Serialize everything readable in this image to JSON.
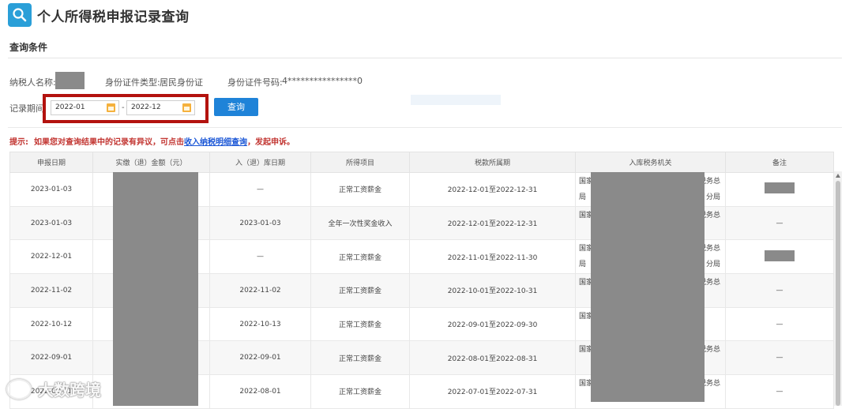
{
  "header": {
    "title": "个人所得税申报记录查询",
    "icon": "search-icon"
  },
  "section": {
    "title": "查询条件"
  },
  "fields": {
    "taxpayer_label": "纳税人名称:",
    "id_type_label": "身份证件类型:",
    "id_type_value": "居民身份证",
    "id_no_label": "身份证件号码:",
    "id_no_value": "4****************0",
    "period_label": "记录期间:",
    "date_from": "2022-01",
    "date_to": "2022-12",
    "date_sep": "-"
  },
  "query_button": "查询",
  "hint": {
    "prefix": "提示:",
    "text1": "如果您对查询结果中的记录有异议，可点击",
    "link": "收入纳税明细查询",
    "text2": "，发起申诉。"
  },
  "table": {
    "headers": [
      "申报日期",
      "实缴（退）金额（元）",
      "入（退）库日期",
      "所得项目",
      "税款所属期",
      "入库税务机关",
      "备注"
    ],
    "rows": [
      {
        "date": "2023-01-03",
        "stock_date": "—",
        "item": "正常工资薪金",
        "period": "2022-12-01至2022-12-31",
        "office1": "国家",
        "office2": "税务总",
        "office3": "局",
        "office4": "分局",
        "note": ""
      },
      {
        "date": "2023-01-03",
        "stock_date": "2023-01-03",
        "item": "全年一次性奖金收入",
        "period": "2022-12-01至2022-12-31",
        "office1": "国家",
        "office2": "税务总",
        "office3": "",
        "office4": "",
        "note": "—"
      },
      {
        "date": "2022-12-01",
        "stock_date": "—",
        "item": "正常工资薪金",
        "period": "2022-11-01至2022-11-30",
        "office1": "国家",
        "office2": "税务总",
        "office3": "局",
        "office4": "分局",
        "note": ""
      },
      {
        "date": "2022-11-02",
        "stock_date": "2022-11-02",
        "item": "正常工资薪金",
        "period": "2022-10-01至2022-10-31",
        "office1": "国家",
        "office2": "税务总",
        "office3": "",
        "office4": "",
        "note": "—"
      },
      {
        "date": "2022-10-12",
        "stock_date": "2022-10-13",
        "item": "正常工资薪金",
        "period": "2022-09-01至2022-09-30",
        "office1": "国家",
        "office2": "",
        "office3": "",
        "office4": "",
        "note": "—"
      },
      {
        "date": "2022-09-01",
        "stock_date": "2022-09-01",
        "item": "正常工资薪金",
        "period": "2022-08-01至2022-08-31",
        "office1": "国家",
        "office2": "税务总",
        "office3": "",
        "office4": "",
        "note": "—"
      },
      {
        "date": "2022-08-01",
        "stock_date": "2022-08-01",
        "item": "正常工资薪金",
        "period": "2022-07-01至2022-07-31",
        "office1": "国家",
        "office2": "税务总",
        "office3": "",
        "office4": "",
        "note": "—"
      }
    ]
  },
  "watermark": "大数跨境"
}
